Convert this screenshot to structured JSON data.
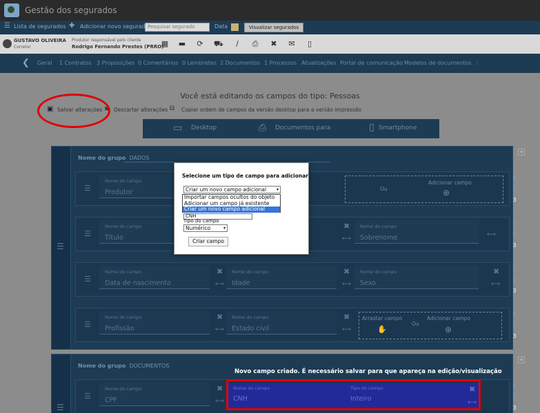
{
  "app": {
    "title": "Gestão dos segurados"
  },
  "toolbar": {
    "list_label": "Lista de segurados",
    "add_label": "Adicionar novo segurado",
    "search_placeholder": "Pesquisar segurado",
    "date_label": "Data",
    "view_label": "Visualizar segurados"
  },
  "user": {
    "name": "GUSTAVO OLIVEIRA",
    "role": "Corretor",
    "producer_label": "Produtor responsável pelo cliente",
    "producer": "Rodrigo Fernando Prestes (PRRO)"
  },
  "nav": {
    "items": [
      "Geral",
      "1 Contratos",
      "3 Proposições",
      "0 Comentários",
      "0 Lembretes",
      "2 Documentos",
      "1 Processos",
      "Atualizações",
      "Portal de comunicação",
      "Modelos de documentos"
    ]
  },
  "editor": {
    "heading": "Você está editando os campos do tipo: Pessoas",
    "save": "Salvar alterações",
    "discard": "Descartar alterações",
    "copy": "Copiar ordem de campos da versão desktop para a versão impressão"
  },
  "tabs": [
    "Desktop",
    "Documentos para",
    "Smartphone"
  ],
  "group1": {
    "label": "Nome do grupo",
    "name": "DADOS",
    "rows": [
      {
        "c1_label": "Nome do campo",
        "c1": "Produtor",
        "drop_or": "Ou",
        "drop_add": "Adicionar campo"
      },
      {
        "c1_label": "Nome do campo",
        "c1": "Título",
        "c3_label": "Nome do campo",
        "c3": "Sobrenome"
      },
      {
        "c1_label": "Nome do campo",
        "c1": "Data de nascimento",
        "c2_label": "Nome do campo",
        "c2": "Idade",
        "c3_label": "Nome do campo",
        "c3": "Sexo"
      },
      {
        "c1_label": "Nome do campo",
        "c1": "Profissão",
        "c2_label": "Nome do campo",
        "c2": "Estado civil",
        "drag": "Arrastar campo",
        "or": "Ou",
        "add": "Adicionar campo"
      }
    ],
    "nums": [
      "1",
      "2",
      "3"
    ]
  },
  "group2": {
    "label": "Nome do grupo",
    "name": "DOCUMENTOS",
    "rows": [
      {
        "c1_label": "Nome do campo",
        "c1": "CPF",
        "c2_label": "Nome do campo",
        "c2": "CNH",
        "c3_label": "Tipo do campo",
        "c3": "Inteiro"
      }
    ]
  },
  "dialog": {
    "title": "Selecione um tipo de campo para adicionar",
    "selected": "Criar um novo campo adicional",
    "options": [
      "Importar campos ocultos do objeto",
      "Adicionar um campo já existente",
      "Criar um novo campo adicional"
    ],
    "name_value": "CNH",
    "type_label": "Tipo do campo",
    "type_value": "Numérico",
    "button": "Criar campo"
  },
  "note": "Novo campo criado. É necessário salvar para que apareça na edição/visualização"
}
